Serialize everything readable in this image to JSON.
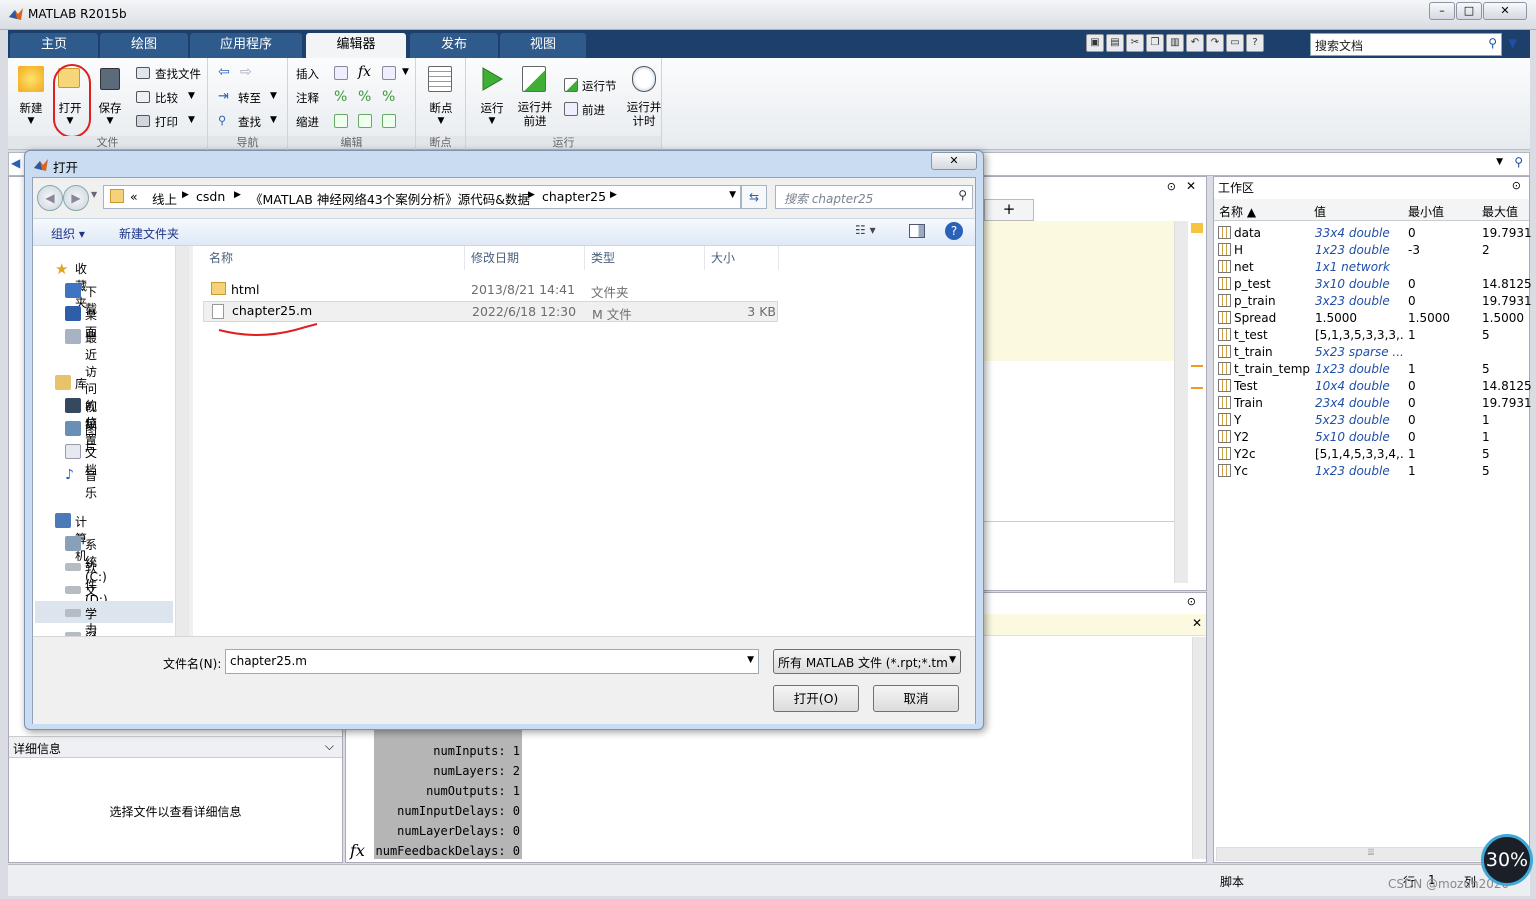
{
  "window": {
    "title": "MATLAB R2015b"
  },
  "tabs": [
    "主页",
    "绘图",
    "应用程序",
    "编辑器",
    "发布",
    "视图"
  ],
  "search_docs": {
    "placeholder": "搜索文档"
  },
  "toolstrip": {
    "file": {
      "label": "文件",
      "new": "新建",
      "open": "打开",
      "save": "保存",
      "find_files": "查找文件",
      "compare": "比较",
      "print": "打印"
    },
    "navigate": {
      "label": "导航",
      "goto": "转至",
      "find": "查找"
    },
    "edit": {
      "label": "编辑",
      "insert": "插入",
      "fx": "fx",
      "comment": "注释",
      "indent": "缩进"
    },
    "breakpoints": {
      "label": "断点",
      "bp": "断点"
    },
    "run": {
      "label": "运行",
      "run": "运行",
      "run_advance": "运行并\n前进",
      "run_section": "运行节",
      "advance": "前进",
      "run_time": "运行并\n计时"
    }
  },
  "left_panel": {
    "details_title": "详细信息",
    "details_hint": "选择文件以查看详细信息"
  },
  "command_window": {
    "lines": [
      "numInputs: 1",
      "numLayers: 2",
      "numOutputs: 1",
      "numInputDelays: 0",
      "numLayerDelays: 0",
      "numFeedbackDelays: 0"
    ],
    "fx": "fx"
  },
  "workspace": {
    "title": "工作区",
    "columns": [
      "名称 ▲",
      "值",
      "最小值",
      "最大值"
    ],
    "rows": [
      {
        "name": "data",
        "value": "33x4 double",
        "min": "0",
        "max": "19.7931",
        "link": true
      },
      {
        "name": "H",
        "value": "1x23 double",
        "min": "-3",
        "max": "2",
        "link": true
      },
      {
        "name": "net",
        "value": "1x1 network",
        "min": "",
        "max": "",
        "link": true
      },
      {
        "name": "p_test",
        "value": "3x10 double",
        "min": "0",
        "max": "14.8125",
        "link": true
      },
      {
        "name": "p_train",
        "value": "3x23 double",
        "min": "0",
        "max": "19.7931",
        "link": true
      },
      {
        "name": "Spread",
        "value": "1.5000",
        "min": "1.5000",
        "max": "1.5000",
        "link": false
      },
      {
        "name": "t_test",
        "value": "[5,1,3,5,3,3,3,...",
        "min": "1",
        "max": "5",
        "link": false
      },
      {
        "name": "t_train",
        "value": "5x23 sparse ...",
        "min": "",
        "max": "",
        "link": true
      },
      {
        "name": "t_train_temp",
        "value": "1x23 double",
        "min": "1",
        "max": "5",
        "link": true
      },
      {
        "name": "Test",
        "value": "10x4 double",
        "min": "0",
        "max": "14.8125",
        "link": true
      },
      {
        "name": "Train",
        "value": "23x4 double",
        "min": "0",
        "max": "19.7931",
        "link": true
      },
      {
        "name": "Y",
        "value": "5x23 double",
        "min": "0",
        "max": "1",
        "link": true
      },
      {
        "name": "Y2",
        "value": "5x10 double",
        "min": "0",
        "max": "1",
        "link": true
      },
      {
        "name": "Y2c",
        "value": "[5,1,4,5,3,3,4,...",
        "min": "1",
        "max": "5",
        "link": false
      },
      {
        "name": "Yc",
        "value": "1x23 double",
        "min": "1",
        "max": "5",
        "link": true
      }
    ]
  },
  "statusbar": {
    "script": "脚本",
    "row_label": "行",
    "row": "1",
    "col_label": "列",
    "zoom": "30%",
    "watermark": "CSDN @mozun2020"
  },
  "dialog": {
    "title": "打开",
    "breadcrumb": [
      "«",
      "线上",
      "csdn",
      "《MATLAB 神经网络43个案例分析》源代码&数据",
      "chapter25"
    ],
    "search_placeholder": "搜索 chapter25",
    "organize": "组织 ▾",
    "new_folder": "新建文件夹",
    "nav": {
      "favorites": "收藏夹",
      "downloads": "下载",
      "desktop": "桌面",
      "recent": "最近访问的位置",
      "library": "库",
      "videos": "视频",
      "pictures": "图片",
      "documents": "文档",
      "music": "音乐",
      "computer": "计算机",
      "drive_c": "系统 (C:)",
      "drive_d": "软件 (D:)",
      "drive_e": "文档/工程 (E:)",
      "drive_f": "学习 (F:)",
      "drive_g": "深度学习 (G:)"
    },
    "columns": [
      "名称",
      "修改日期",
      "类型",
      "大小"
    ],
    "files": [
      {
        "name": "html",
        "date": "2013/8/21 14:41",
        "type": "文件夹",
        "size": ""
      },
      {
        "name": "chapter25.m",
        "date": "2022/6/18 12:30",
        "type": "M 文件",
        "size": "3 KB"
      }
    ],
    "filename_label": "文件名(N):",
    "filename_value": "chapter25.m",
    "filetype": "所有 MATLAB 文件 (*.rpt;*.tm",
    "open_button": "打开(O)",
    "cancel_button": "取消"
  }
}
